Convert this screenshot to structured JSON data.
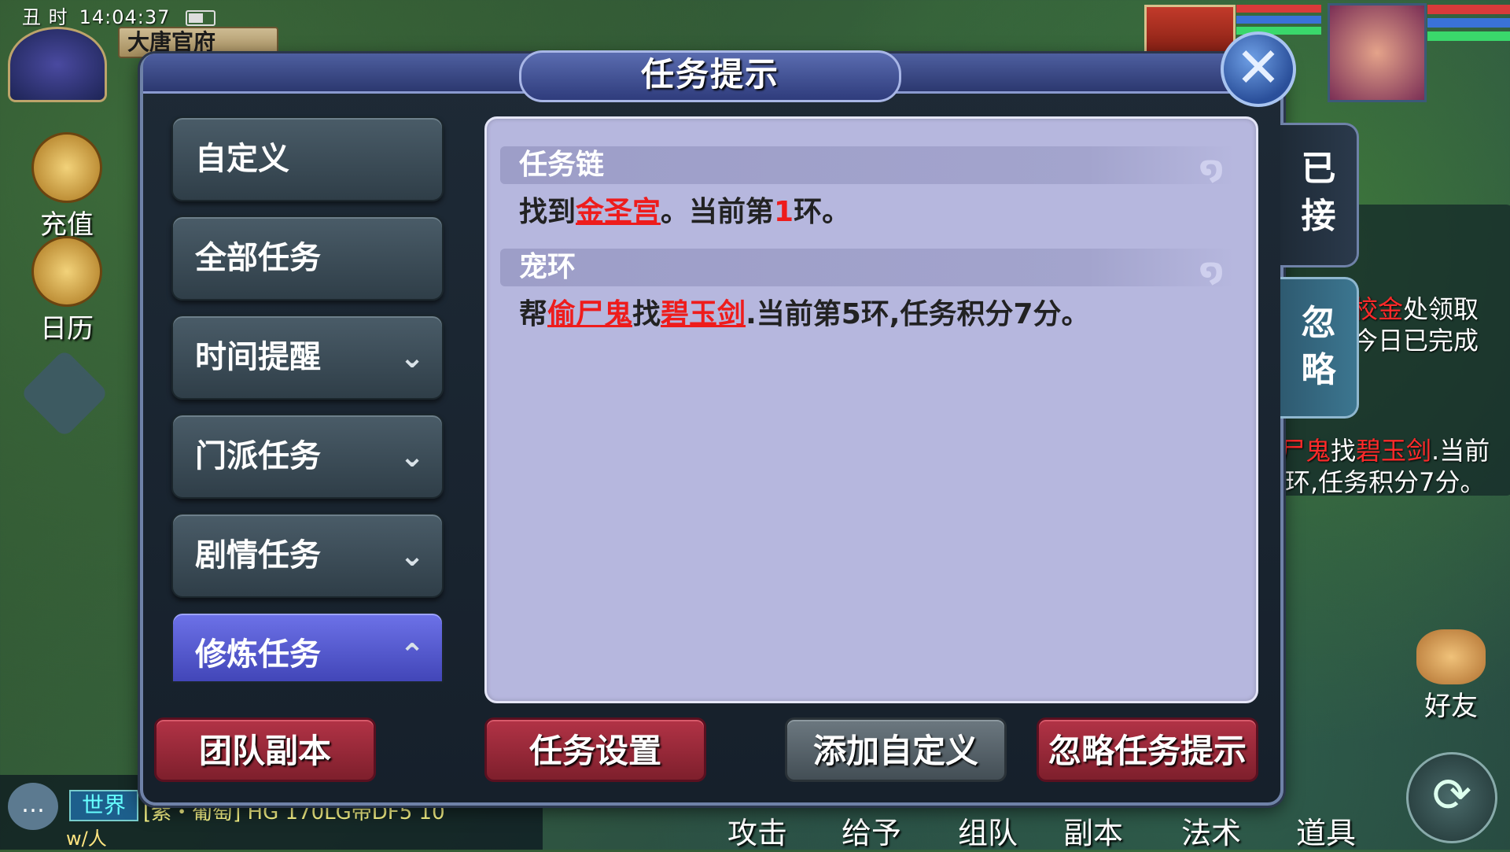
{
  "hud": {
    "hour_label": "丑 时",
    "clock": "14:04:37",
    "location": "大唐官府",
    "recharge_label": "充值",
    "calendar_label": "日历"
  },
  "dialog": {
    "title": "任务提示",
    "close_glyph": "✕",
    "categories": [
      {
        "label": "自定义",
        "chevron": ""
      },
      {
        "label": "全部任务",
        "chevron": ""
      },
      {
        "label": "时间提醒",
        "chevron": "⌄"
      },
      {
        "label": "门派任务",
        "chevron": "⌄"
      },
      {
        "label": "剧情任务",
        "chevron": "⌄"
      },
      {
        "label": "修炼任务",
        "chevron": "⌃"
      }
    ],
    "sections": [
      {
        "header": "任务链",
        "body": {
          "pre": "找到",
          "link1": "金圣宫",
          "mid1": "。当前第",
          "num": "1",
          "post": "环。"
        }
      },
      {
        "header": "宠环",
        "body": {
          "pre": "帮",
          "link1": "偷尸鬼",
          "mid1": "找",
          "link2": "碧玉剑",
          "post": ".当前第5环,任务积分7分。"
        }
      }
    ],
    "tabs": {
      "accepted": "已接",
      "ignored": "忽略"
    },
    "buttons": {
      "team_dungeon": "团队副本",
      "task_settings": "任务设置",
      "add_custom": "添加自定义",
      "ignore_hints": "忽略任务提示"
    }
  },
  "background_tracker": {
    "line1_link": "校金",
    "line1_rest": "处领取",
    "line2": "今日已完成",
    "line3_link1": "尸鬼",
    "line3_mid": "找",
    "line3_link2": "碧玉剑",
    "line3_rest": ".当前",
    "line4": "环,任务积分7分。"
  },
  "bottom_hud": {
    "chat_channel": "世界",
    "chat_message": "[紫・葡萄] HG 170LG带DF5  10",
    "chat_sender": "w/人",
    "actions": [
      "攻击",
      "给予",
      "组队",
      "副本",
      "法术",
      "道具"
    ],
    "friends_label": "好友"
  },
  "colors": {
    "accent_red": "#ee1c1c",
    "active_tab": "#5a5fd6",
    "content_bg": "#b6b7de"
  }
}
